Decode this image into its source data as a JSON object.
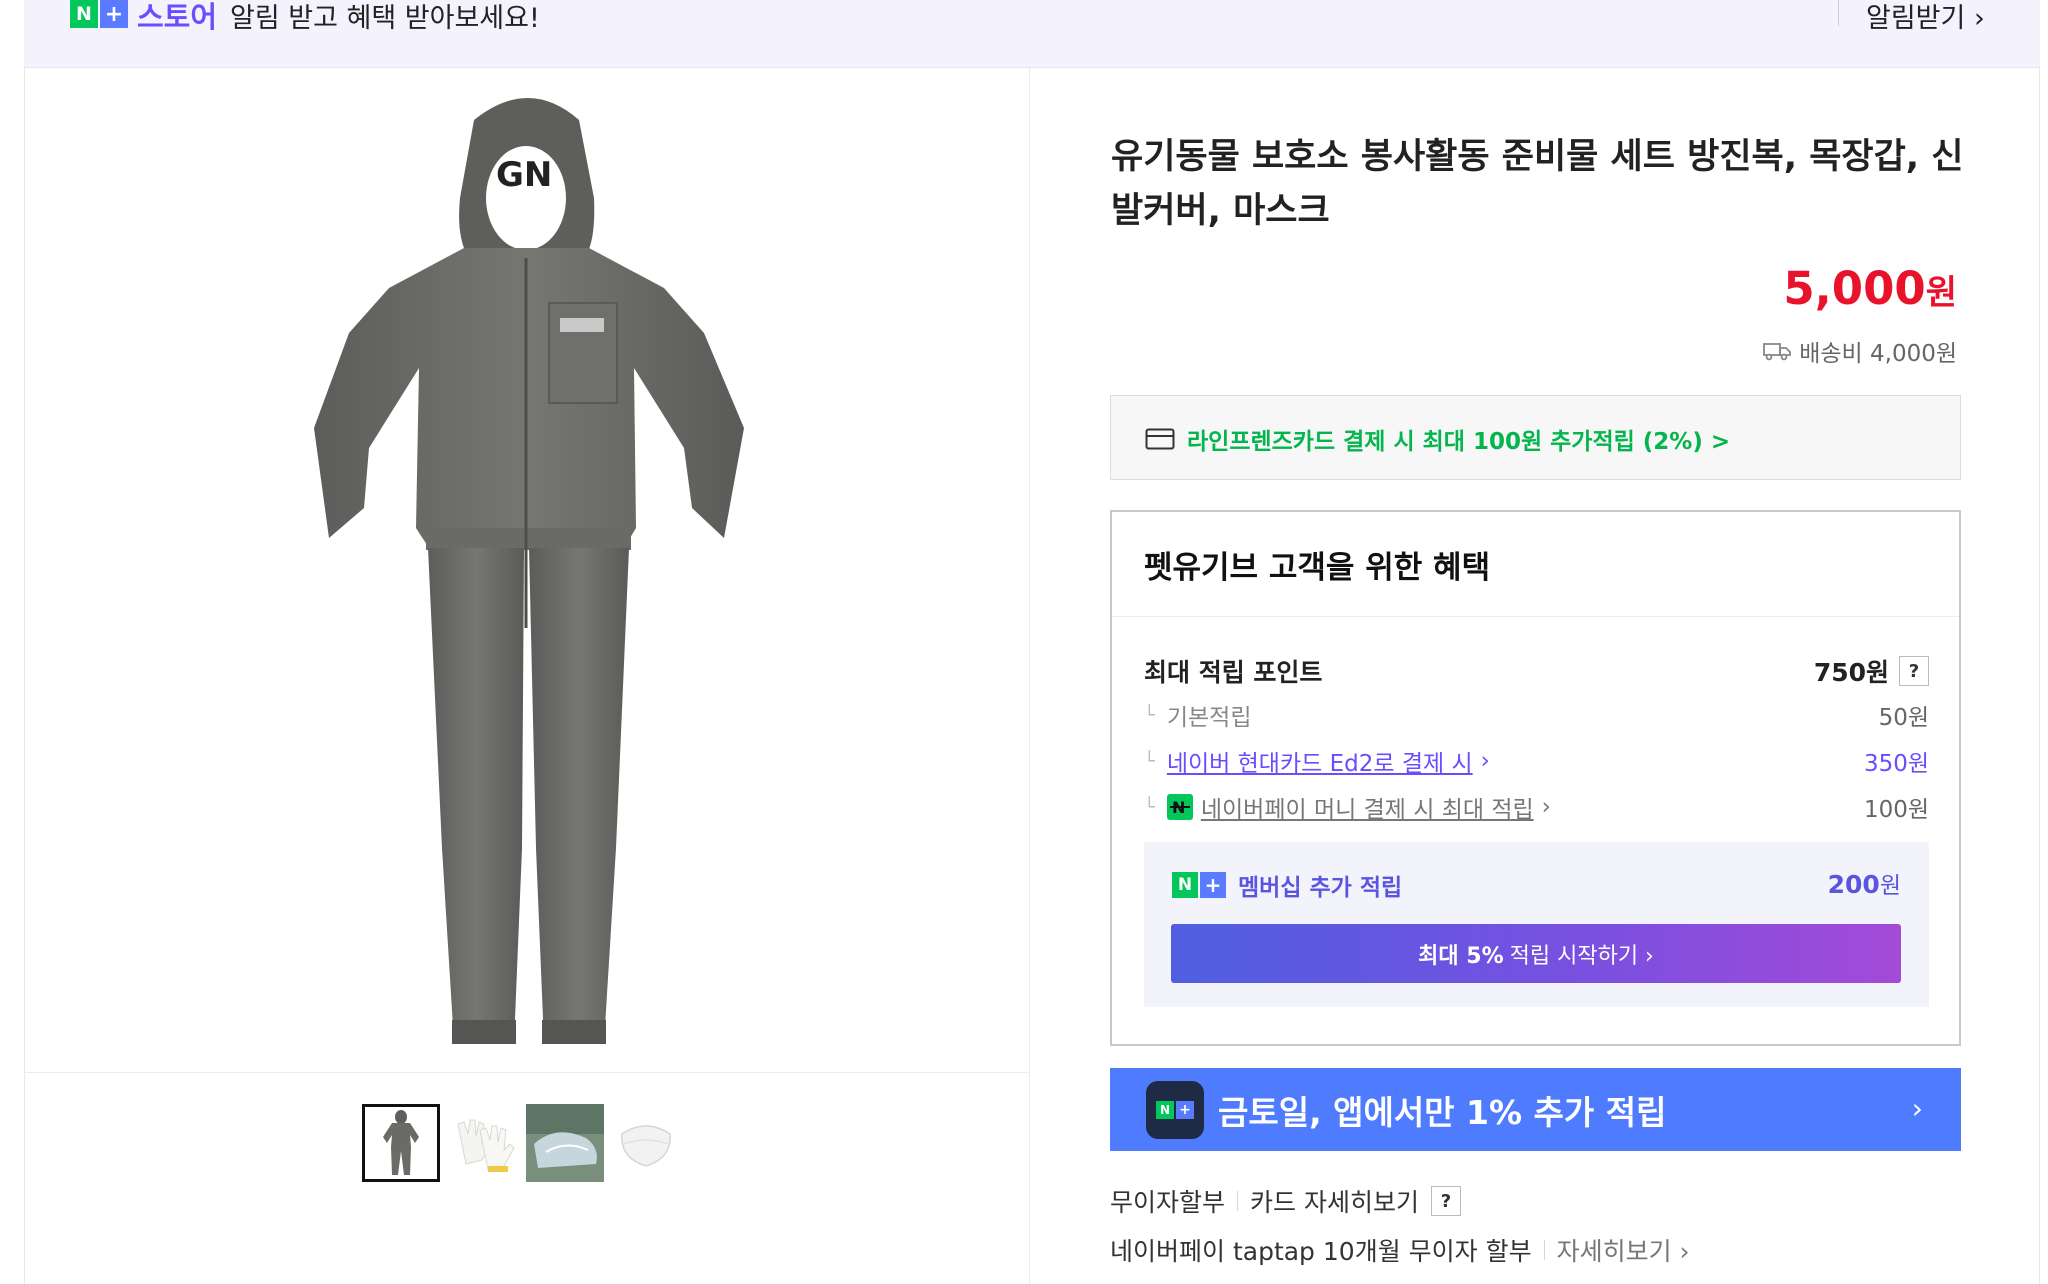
{
  "banner": {
    "badge_n": "N",
    "badge_plus": "+",
    "store_label": "스토어",
    "message": "알림 받고 혜택 받아보세요!",
    "alarm_link": "알림받기 ›"
  },
  "gallery": {
    "main_image": "hooded-coverall-suit",
    "thumbnails": [
      {
        "name": "coverall-suit",
        "active": true
      },
      {
        "name": "cotton-gloves",
        "active": false
      },
      {
        "name": "shoe-covers",
        "active": false
      },
      {
        "name": "face-mask",
        "active": false
      }
    ]
  },
  "product": {
    "title": "유기동물 보호소 봉사활동 준비물 세트 방진복, 목장갑, 신발커버, 마스크",
    "price": "5,000",
    "price_unit": "원",
    "shipping": "배송비 4,000원"
  },
  "card_promo": {
    "text": "라인프렌즈카드 결제 시 최대 100원 추가적립 (2%) >"
  },
  "benefits": {
    "heading": "펫유기브 고객을 위한 혜택",
    "max_points_label": "최대 적립 포인트",
    "max_points_value": "750원",
    "help": "?",
    "rows": [
      {
        "label": "기본적립",
        "value": "50원"
      },
      {
        "label": "네이버 현대카드 Ed2로 결제 시",
        "value": "350원"
      },
      {
        "label": "네이버페이 머니 결제 시 최대 적립",
        "value": "100원"
      }
    ],
    "tree_mark": "└",
    "chevron": "›",
    "membership_label": "멤버십 추가 적립",
    "membership_value": "200",
    "membership_unit": "원",
    "membership_button_bold": "최대 5%",
    "membership_button_rest": "적립 시작하기 ›"
  },
  "app_banner": {
    "text": "금토일, 앱에서만 1% 추가 적립",
    "chevron": "›"
  },
  "installment": {
    "label": "무이자할부",
    "card_detail": "카드 자세히보기",
    "help": "?",
    "npay_text": "네이버페이 taptap 10개월 무이자 할부",
    "detail_link": "자세히보기 ›"
  },
  "colors": {
    "price_red": "#e8122b",
    "naver_green": "#03c75a",
    "member_purple": "#5a55e0",
    "app_blue": "#4f7cff"
  }
}
